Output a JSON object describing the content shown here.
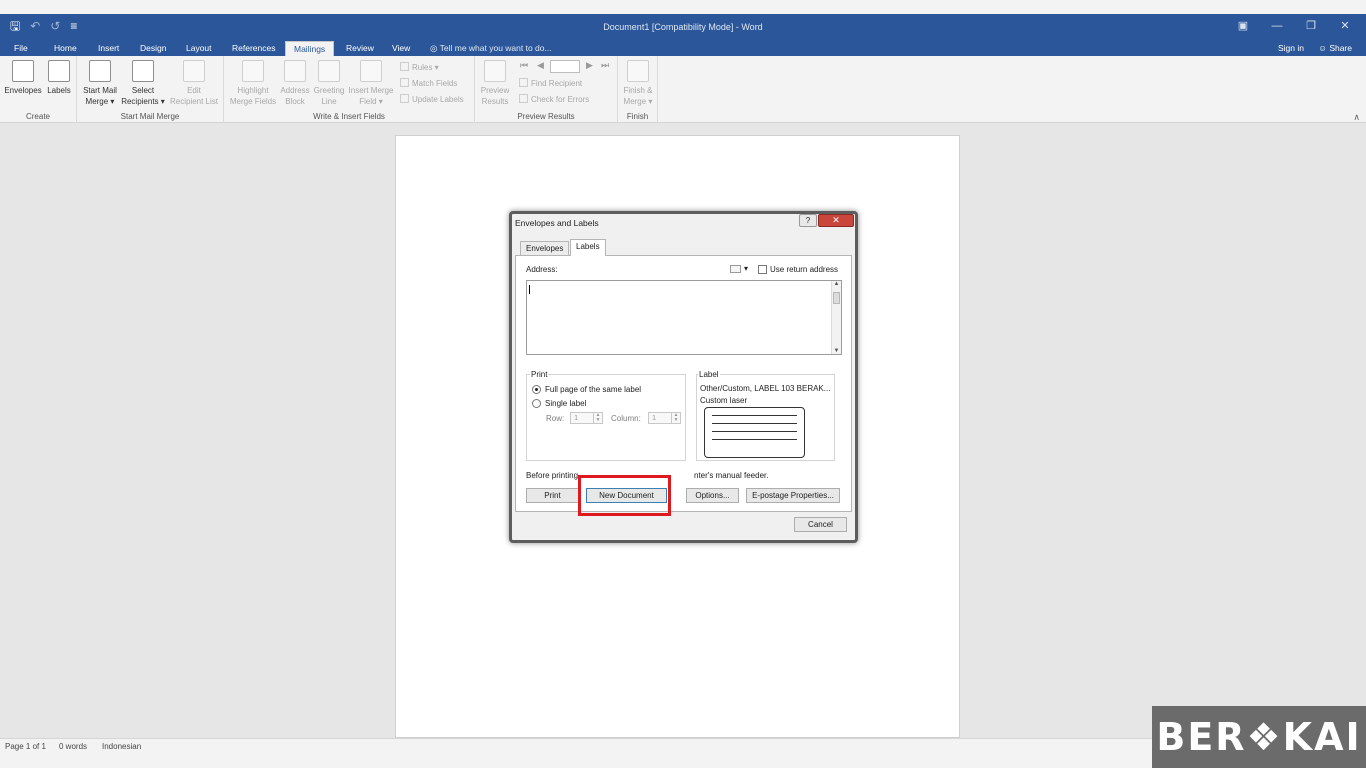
{
  "title_bar": {
    "title": "Document1 [Compatibility Mode] - Word",
    "qat_save_icon": "save-icon",
    "qat_undo_icon": "undo-icon",
    "qat_redo_icon": "redo-icon"
  },
  "tabs": [
    {
      "label": "File"
    },
    {
      "label": "Home"
    },
    {
      "label": "Insert"
    },
    {
      "label": "Design"
    },
    {
      "label": "Layout"
    },
    {
      "label": "References"
    },
    {
      "label": "Mailings",
      "active": true
    },
    {
      "label": "Review"
    },
    {
      "label": "View"
    }
  ],
  "tell_me": "Tell me what you want to do...",
  "sign_in": "Sign in",
  "share": "Share",
  "ribbon": {
    "create": {
      "label": "Create",
      "envelopes": "Envelopes",
      "labels": "Labels"
    },
    "start_mail_merge": {
      "label": "Start Mail Merge",
      "start_line1": "Start Mail",
      "start_line2": "Merge ▾",
      "select_line1": "Select",
      "select_line2": "Recipients ▾",
      "edit_line1": "Edit",
      "edit_line2": "Recipient List"
    },
    "write_insert": {
      "label": "Write & Insert Fields",
      "highlight_line1": "Highlight",
      "highlight_line2": "Merge Fields",
      "address_line1": "Address",
      "address_line2": "Block",
      "greeting_line1": "Greeting",
      "greeting_line2": "Line",
      "insert_line1": "Insert Merge",
      "insert_line2": "Field ▾",
      "rules": "Rules ▾",
      "match_fields": "Match Fields",
      "update_labels": "Update Labels"
    },
    "preview_results": {
      "label": "Preview Results",
      "preview_line1": "Preview",
      "preview_line2": "Results",
      "find_recipient": "Find Recipient",
      "check_errors": "Check for Errors"
    },
    "finish": {
      "label": "Finish",
      "finish_line1": "Finish &",
      "finish_line2": "Merge ▾"
    }
  },
  "dialog": {
    "title": "Envelopes and Labels",
    "help": "?",
    "close": "✕",
    "tab_envelopes": "Envelopes",
    "tab_labels": "Labels",
    "address_label": "Address:",
    "use_return_address": "Use return address",
    "print_group": "Print",
    "full_page": "Full page of the same label",
    "single_label": "Single label",
    "row_label": "Row:",
    "row_value": "1",
    "column_label": "Column:",
    "column_value": "1",
    "label_group": "Label",
    "label_name": "Other/Custom, LABEL 103 BERAK...",
    "label_type": "Custom laser",
    "note_left": "Before printing,",
    "note_right": "nter's manual feeder.",
    "btn_print": "Print",
    "btn_new_document": "New Document",
    "btn_options": "Options...",
    "btn_epostage": "E-postage Properties...",
    "btn_cancel": "Cancel"
  },
  "status": {
    "page": "Page 1 of 1",
    "words": "0 words",
    "language": "Indonesian"
  },
  "watermark": "BER❖KAI",
  "colors": {
    "title_bar": "#2b579a",
    "ribbon": "#f3f3f3",
    "highlight": "#e0191f"
  }
}
